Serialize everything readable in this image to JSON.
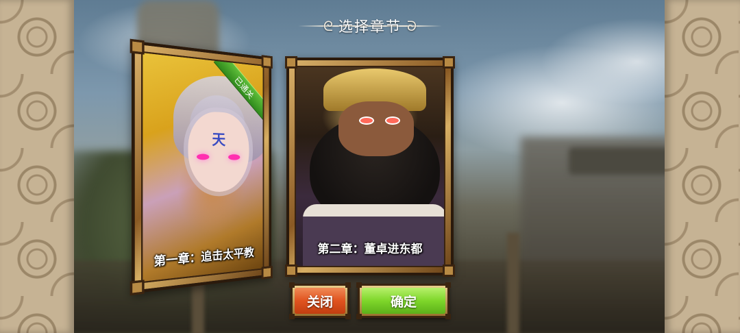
{
  "header": {
    "title": "选择章节",
    "left_ornament": "ornament-curl-icon",
    "right_ornament": "ornament-curl-icon"
  },
  "chapters": [
    {
      "label": "第一章：追击太平教",
      "badge": "已通关",
      "badge_color": "#3c9a22"
    },
    {
      "label": "第二章：董卓进东都"
    }
  ],
  "buttons": {
    "close_label": "关闭",
    "confirm_label": "确定",
    "close_color": "#e0531f",
    "confirm_color": "#7ed62a"
  }
}
